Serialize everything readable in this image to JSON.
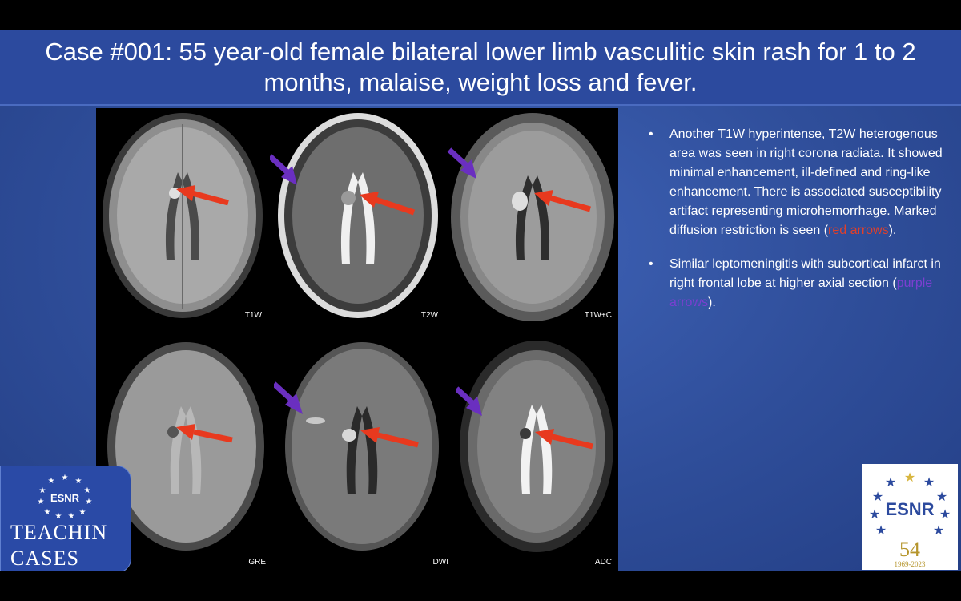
{
  "slide": {
    "title": "Case #001: 55 year-old female bilateral lower limb vasculitic skin rash for 1 to 2 months, malaise, weight loss and fever."
  },
  "panels": [
    {
      "label": "T1W"
    },
    {
      "label": "T2W"
    },
    {
      "label": "T1W+C"
    },
    {
      "label": "GRE"
    },
    {
      "label": "DWI"
    },
    {
      "label": "ADC"
    }
  ],
  "bullets": [
    {
      "before": "Another T1W hyperintense, T2W heterogenous area was seen in right corona radiata. It showed minimal enhancement, ill-defined and ring-like enhancement. There is associated susceptibility artifact representing microhemorrhage. Marked diffusion restriction is seen (",
      "highlight": "red arrows",
      "after": ")."
    },
    {
      "before": "Similar leptomeningitis with subcortical infarct in right frontal lobe at higher axial section (",
      "highlight": "purple arrows",
      "after": ")."
    }
  ],
  "colors": {
    "red_arrow": "#e8391e",
    "purple_arrow": "#6a2fc0",
    "title_bar": "#2c4a9e"
  },
  "logos": {
    "left": {
      "abbr": "ESNR",
      "line1": "TEACHIN",
      "line2": "CASES"
    },
    "right": {
      "abbr": "ESNR",
      "anniversary": "54",
      "years": "1969-2023"
    }
  }
}
